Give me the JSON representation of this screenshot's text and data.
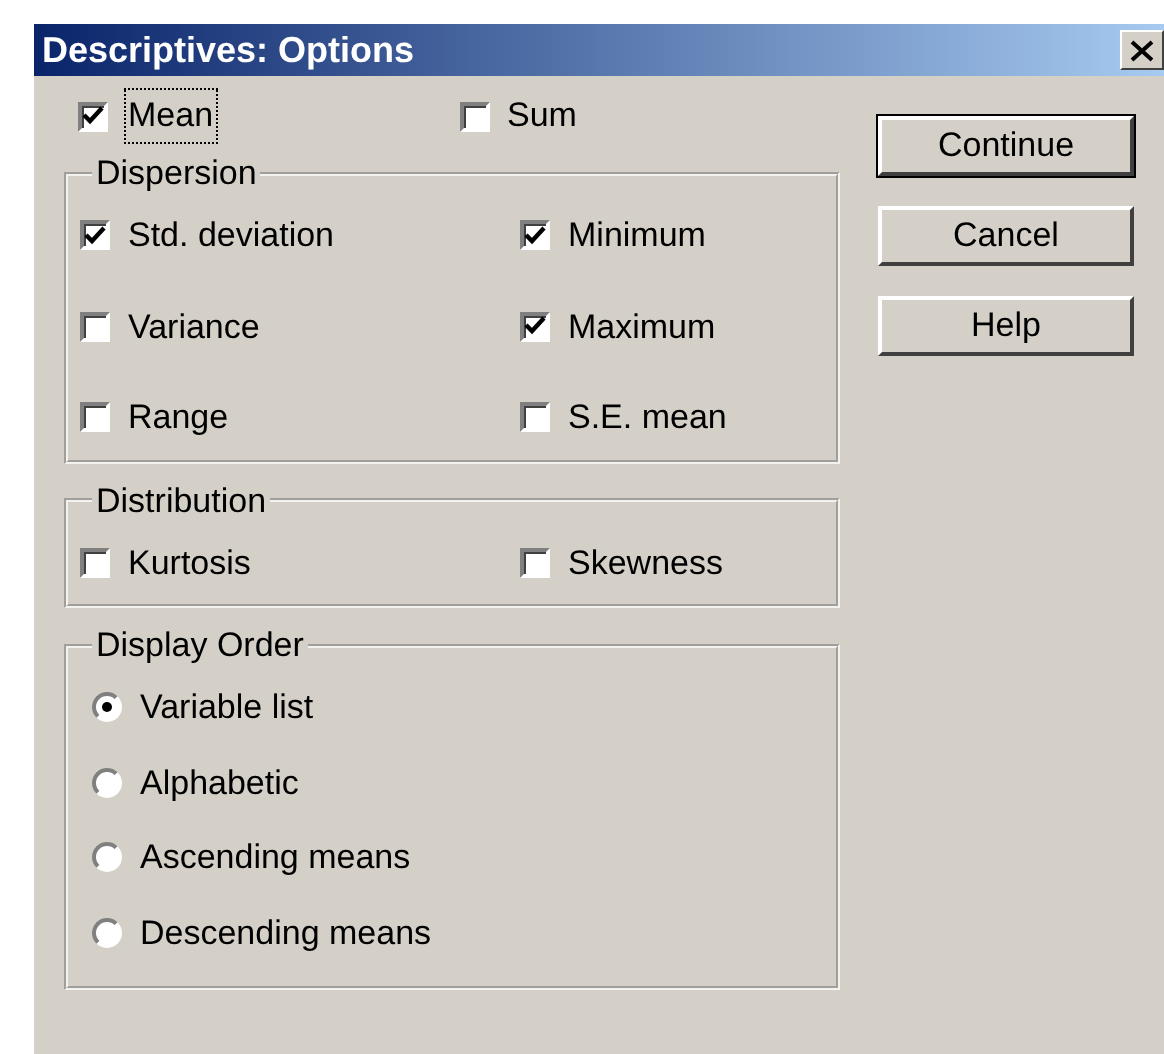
{
  "window": {
    "title": "Descriptives: Options"
  },
  "top_options": [
    {
      "label": "Mean",
      "checked": true,
      "focused": true
    },
    {
      "label": "Sum",
      "checked": false,
      "focused": false
    }
  ],
  "groups": [
    {
      "title": "Dispersion",
      "kind": "checkbox",
      "items": [
        {
          "label": "Std. deviation",
          "checked": true
        },
        {
          "label": "Minimum",
          "checked": true
        },
        {
          "label": "Variance",
          "checked": false
        },
        {
          "label": "Maximum",
          "checked": true
        },
        {
          "label": "Range",
          "checked": false
        },
        {
          "label": "S.E. mean",
          "checked": false
        }
      ]
    },
    {
      "title": "Distribution",
      "kind": "checkbox",
      "items": [
        {
          "label": "Kurtosis",
          "checked": false
        },
        {
          "label": "Skewness",
          "checked": false
        }
      ]
    },
    {
      "title": "Display Order",
      "kind": "radio",
      "items": [
        {
          "label": "Variable list",
          "selected": true
        },
        {
          "label": "Alphabetic",
          "selected": false
        },
        {
          "label": "Ascending means",
          "selected": false
        },
        {
          "label": "Descending means",
          "selected": false
        }
      ]
    }
  ],
  "buttons": [
    {
      "label": "Continue",
      "default": true
    },
    {
      "label": "Cancel",
      "default": false
    },
    {
      "label": "Help",
      "default": false
    }
  ]
}
